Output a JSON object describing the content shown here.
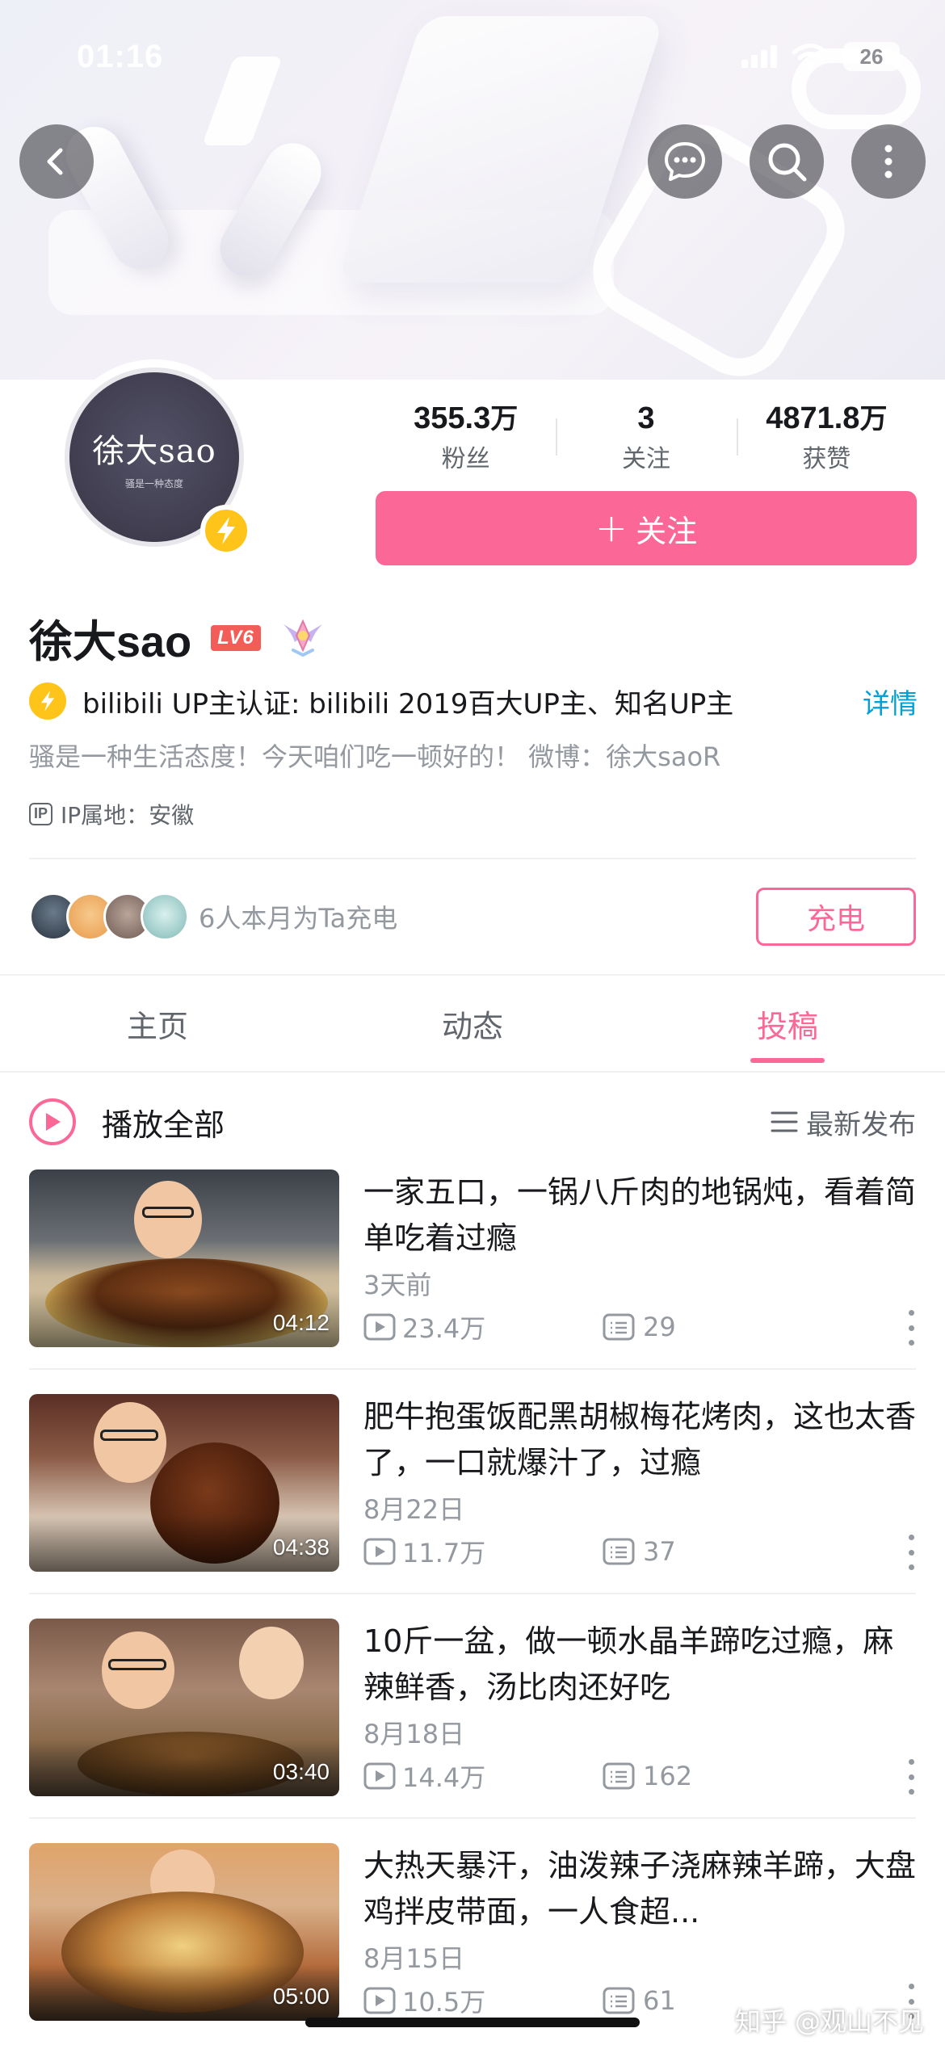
{
  "status_bar": {
    "time": "01:16",
    "battery": "26"
  },
  "profile": {
    "avatar_logo": "徐大sao",
    "avatar_sub": "骚是一种态度",
    "username": "徐大sao",
    "level": "LV6",
    "stats": [
      {
        "value": "355.3",
        "unit": "万",
        "label": "粉丝"
      },
      {
        "value": "3",
        "unit": "",
        "label": "关注"
      },
      {
        "value": "4871.8",
        "unit": "万",
        "label": "获赞"
      }
    ],
    "follow_plus": "+",
    "follow_label": "关注",
    "certification": "bilibili UP主认证: bilibili 2019百大UP主、知名UP主",
    "cert_detail": "详情",
    "bio": "骚是一种生活态度！今天咱们吃一顿好的！ 微博：徐大saoR",
    "ip_tag": "IP",
    "ip_location": "IP属地：安徽",
    "charge_text": "6人本月为Ta充电",
    "charge_button": "充电"
  },
  "tabs": [
    {
      "label": "主页",
      "active": false
    },
    {
      "label": "动态",
      "active": false
    },
    {
      "label": "投稿",
      "active": true
    }
  ],
  "play_all": {
    "label": "播放全部",
    "sort_label": "最新发布"
  },
  "videos": [
    {
      "title": "一家五口，一锅八斤肉的地锅炖，看着简单吃着过瘾",
      "duration": "04:12",
      "date": "3天前",
      "views": "23.4万",
      "comments": "29"
    },
    {
      "title": "肥牛抱蛋饭配黑胡椒梅花烤肉，这也太香了，一口就爆汁了，过瘾",
      "duration": "04:38",
      "date": "8月22日",
      "views": "11.7万",
      "comments": "37"
    },
    {
      "title": "10斤一盆，做一顿水晶羊蹄吃过瘾，麻辣鲜香，汤比肉还好吃",
      "duration": "03:40",
      "date": "8月18日",
      "views": "14.4万",
      "comments": "162"
    },
    {
      "title": "大热天暴汗，油泼辣子浇麻辣羊蹄，大盘鸡拌皮带面，一人食超...",
      "duration": "05:00",
      "date": "8月15日",
      "views": "10.5万",
      "comments": "61"
    }
  ],
  "watermark": "知乎 @观山不见",
  "colors": {
    "accent": "#fb6796",
    "link": "#00a1d6",
    "verify": "#ffc41a"
  },
  "icons": [
    "back-icon",
    "message-icon",
    "search-icon",
    "more-icon",
    "lightning-icon",
    "play-icon",
    "sort-icon",
    "views-icon",
    "comments-icon"
  ]
}
